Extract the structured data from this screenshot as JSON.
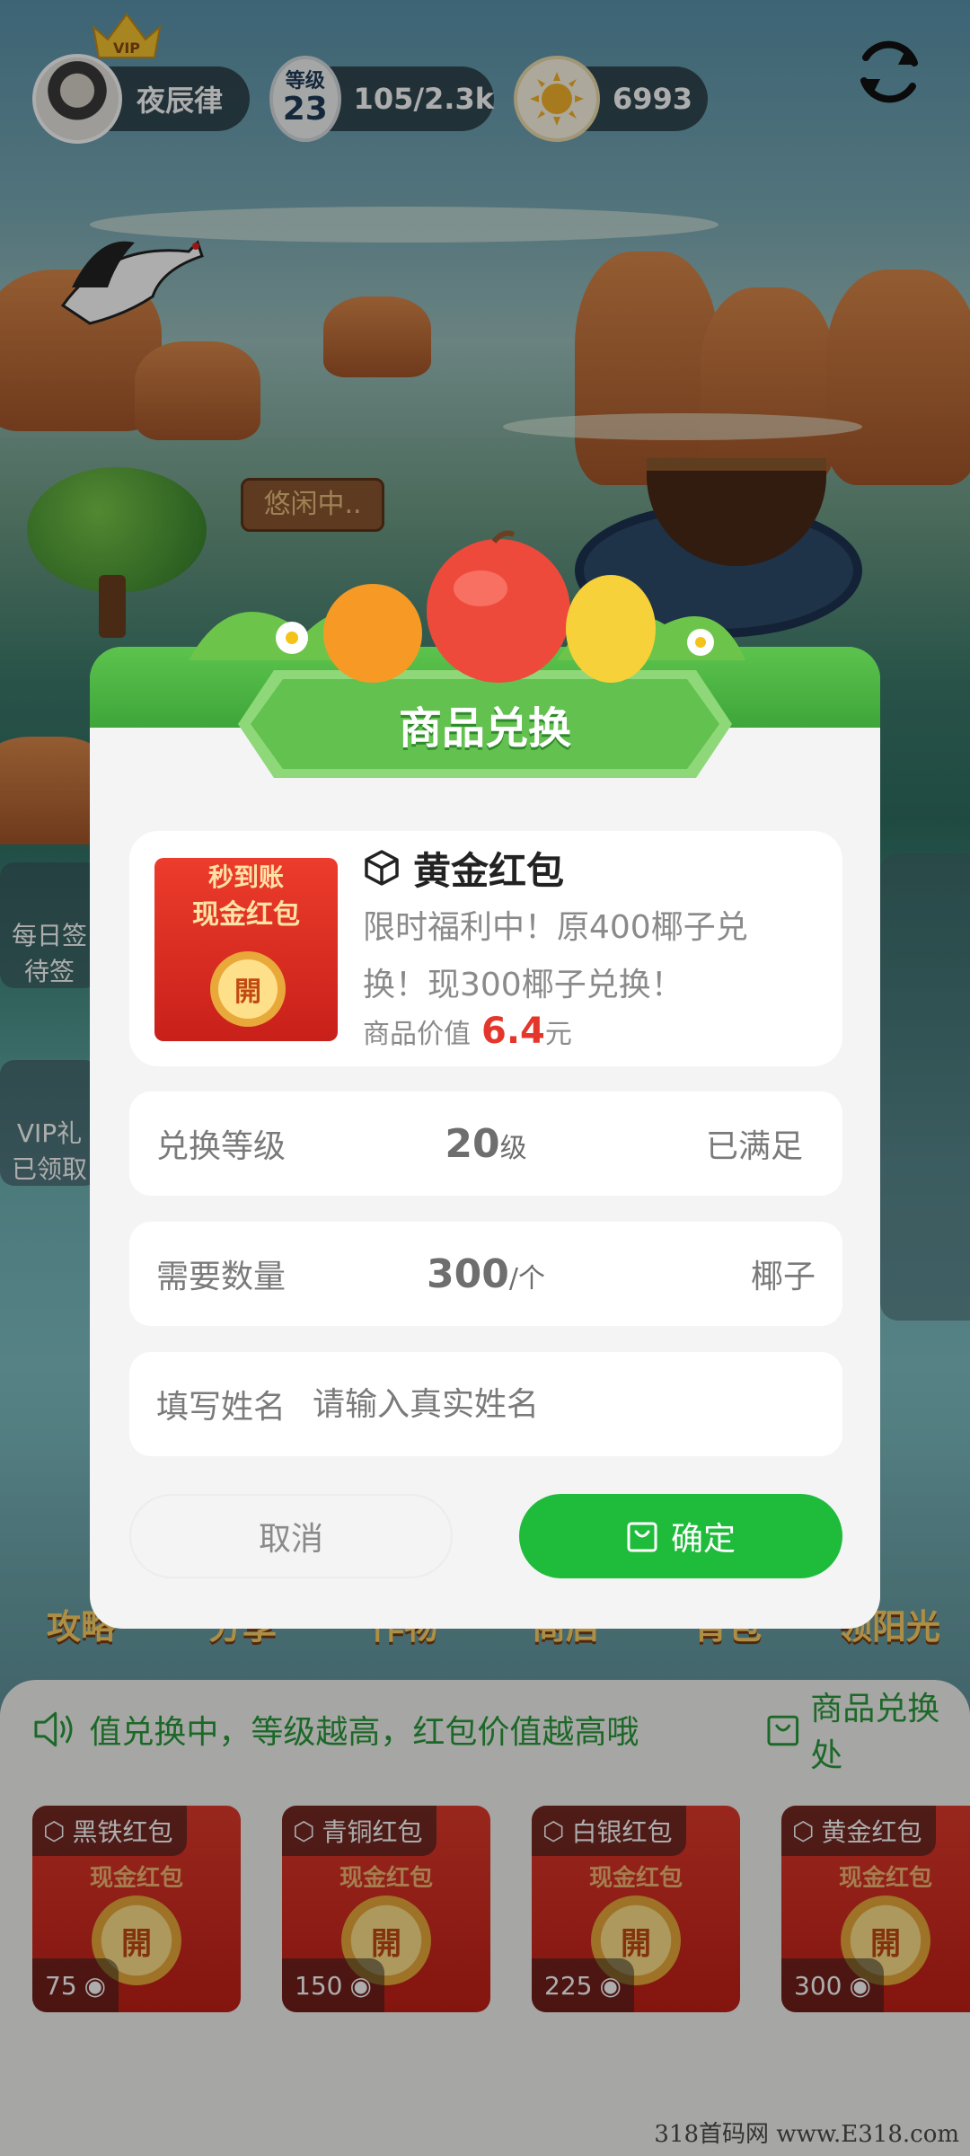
{
  "header": {
    "username": "夜辰律",
    "vip_label": "VIP",
    "level_title": "等级",
    "level_number": "23",
    "exp": "105/2.3k",
    "sun_count": "6993"
  },
  "scene": {
    "sign_text": "悠闲中..",
    "side_left": [
      {
        "label_1": "每日签",
        "label_2": "待签"
      },
      {
        "label_1": "VIP礼",
        "label_2": "已领取"
      }
    ]
  },
  "nav": [
    "攻略",
    "分享",
    "作物",
    "商店",
    "背包",
    "领阳光"
  ],
  "modal": {
    "title": "商品兑换",
    "product": {
      "image_line1": "秒到账",
      "image_line2": "现金红包",
      "image_coin": "開",
      "name": "黄金红包",
      "description": "限时福利中！原400椰子兑换！现300椰子兑换！",
      "value_label": "商品价值",
      "value_number": "6.4",
      "value_unit": "元"
    },
    "level_row": {
      "label": "兑换等级",
      "value": "20",
      "unit": "级",
      "status": "已满足"
    },
    "qty_row": {
      "label": "需要数量",
      "value": "300",
      "unit": "/个",
      "currency": "椰子"
    },
    "name_row": {
      "label": "填写姓名",
      "placeholder": "请输入真实姓名",
      "value": ""
    },
    "cancel_label": "取消",
    "confirm_label": "确定"
  },
  "bottom": {
    "marquee": "值兑换中，等级越高，红包价值越高哦",
    "shop_label": "商品兑换处",
    "cards": [
      {
        "name": "黑铁红包",
        "subtitle": "现金红包",
        "coin": "開",
        "price": "75"
      },
      {
        "name": "青铜红包",
        "subtitle": "现金红包",
        "coin": "開",
        "price": "150"
      },
      {
        "name": "白银红包",
        "subtitle": "现金红包",
        "coin": "開",
        "price": "225"
      },
      {
        "name": "黄金红包",
        "subtitle": "现金红包",
        "coin": "開",
        "price": "300"
      }
    ]
  },
  "watermark": "318首码网 www.E318.com",
  "colors": {
    "accent_green": "#1fbb3a",
    "title_green": "#4cb544",
    "price_red": "#e4362a"
  }
}
